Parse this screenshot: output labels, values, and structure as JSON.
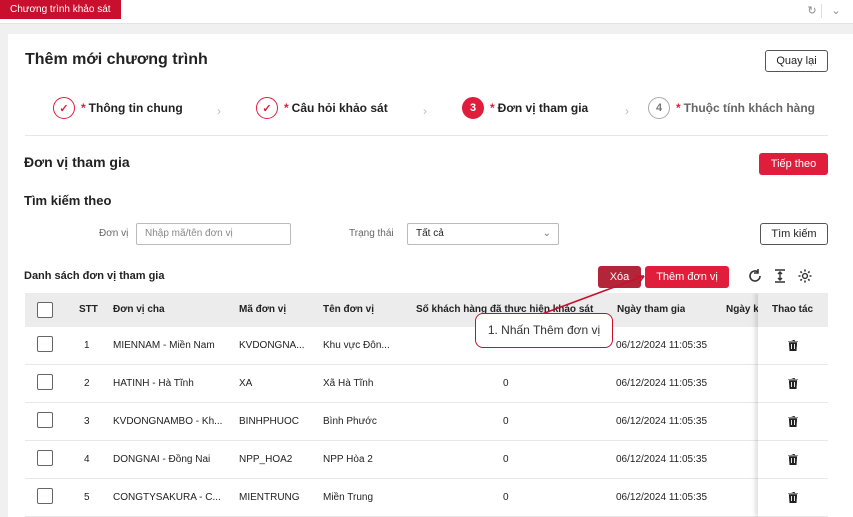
{
  "topbar": {
    "tab_label": "Chương trình khảo sát",
    "refresh_icon": "↻",
    "chevron_icon": "⌄"
  },
  "page": {
    "title": "Thêm mới chương trình",
    "back_label": "Quay lại"
  },
  "steps": [
    {
      "star": "*",
      "label": "Thông tin chung",
      "mark": "✓"
    },
    {
      "star": "*",
      "label": "Câu hỏi khảo sát",
      "mark": "✓"
    },
    {
      "star": "*",
      "label": "Đơn vị tham gia",
      "mark": "3"
    },
    {
      "star": "*",
      "label": "Thuộc tính khách hàng",
      "mark": "4"
    }
  ],
  "section": {
    "title": "Đơn vị tham gia",
    "next_label": "Tiếp theo"
  },
  "search": {
    "title": "Tìm kiếm theo",
    "unit_label": "Đơn vị",
    "unit_placeholder": "Nhập mã/tên đơn vị",
    "status_label": "Trạng thái",
    "status_value": "Tất cả",
    "search_label": "Tìm kiếm"
  },
  "list": {
    "title": "Danh sách đơn vị tham gia",
    "delete_label": "Xóa",
    "add_label": "Thêm đơn vị"
  },
  "table": {
    "headers": {
      "stt": "STT",
      "parent": "Đơn vị cha",
      "code": "Mã đơn vị",
      "name": "Tên đơn vị",
      "count": "Số khách hàng đã thực hiện khảo sát",
      "join": "Ngày tham gia",
      "date2": "Ngày k",
      "action": "Thao tác"
    },
    "rows": [
      {
        "stt": "1",
        "parent": "MIENNAM - Miền Nam",
        "code": "KVDONGNA...",
        "name": "Khu vực Đôn...",
        "count": "0",
        "join": "06/12/2024 11:05:35"
      },
      {
        "stt": "2",
        "parent": "HATINH - Hà Tĩnh",
        "code": "XA",
        "name": "Xã Hà Tĩnh",
        "count": "0",
        "join": "06/12/2024 11:05:35"
      },
      {
        "stt": "3",
        "parent": "KVDONGNAMBO - Kh...",
        "code": "BINHPHUOC",
        "name": "Bình Phước",
        "count": "0",
        "join": "06/12/2024 11:05:35"
      },
      {
        "stt": "4",
        "parent": "DONGNAI - Đồng Nai",
        "code": "NPP_HOA2",
        "name": "NPP Hòa 2",
        "count": "0",
        "join": "06/12/2024 11:05:35"
      },
      {
        "stt": "5",
        "parent": "CONGTYSAKURA - C...",
        "code": "MIENTRUNG",
        "name": "Miền Trung",
        "count": "0",
        "join": "06/12/2024 11:05:35"
      }
    ]
  },
  "annotation": {
    "text": "1. Nhấn Thêm đơn vị"
  },
  "colors": {
    "accent": "#e11d3c",
    "delete": "#b3263a",
    "tab": "#c8102e"
  }
}
